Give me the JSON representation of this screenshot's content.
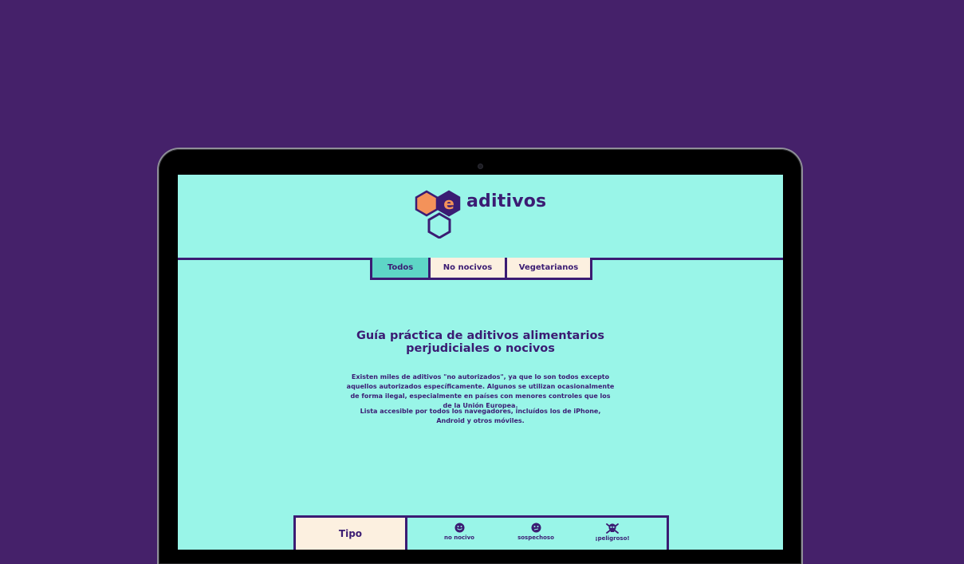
{
  "header": {
    "logo_letter": "e",
    "brand_name": "aditivos"
  },
  "tabs": [
    {
      "label": "Todos",
      "active": true
    },
    {
      "label": "No nocivos",
      "active": false
    },
    {
      "label": "Vegetarianos",
      "active": false
    }
  ],
  "main": {
    "title_line1": "Guía práctica de aditivos alimentarios",
    "title_line2": "perjudiciales o nocivos",
    "paragraph1": "Existen miles de aditivos \"no autorizados\", ya que lo son todos excepto aquellos autorizados específicamente. Algunos se utilizan ocasionalmente de forma ilegal, especialmente en países con menores controles que los de la Unión Europea.",
    "paragraph2": "Lista accesible por todos los navegadores, incluídos los de iPhone, Android y otros móviles."
  },
  "table": {
    "tipo_header": "Tipo",
    "legend": [
      {
        "label": "no nocivo",
        "icon": "smiley-happy-icon"
      },
      {
        "label": "sospechoso",
        "icon": "smiley-neutral-icon"
      },
      {
        "label": "¡peligroso!",
        "icon": "skull-crossbones-icon"
      }
    ]
  },
  "colors": {
    "background": "#45216a",
    "screen": "#99f5e8",
    "primary": "#3b1c73",
    "accent_orange": "#f4925a",
    "tab_active": "#5ed6c6",
    "tab_inactive": "#fcf0e0"
  }
}
